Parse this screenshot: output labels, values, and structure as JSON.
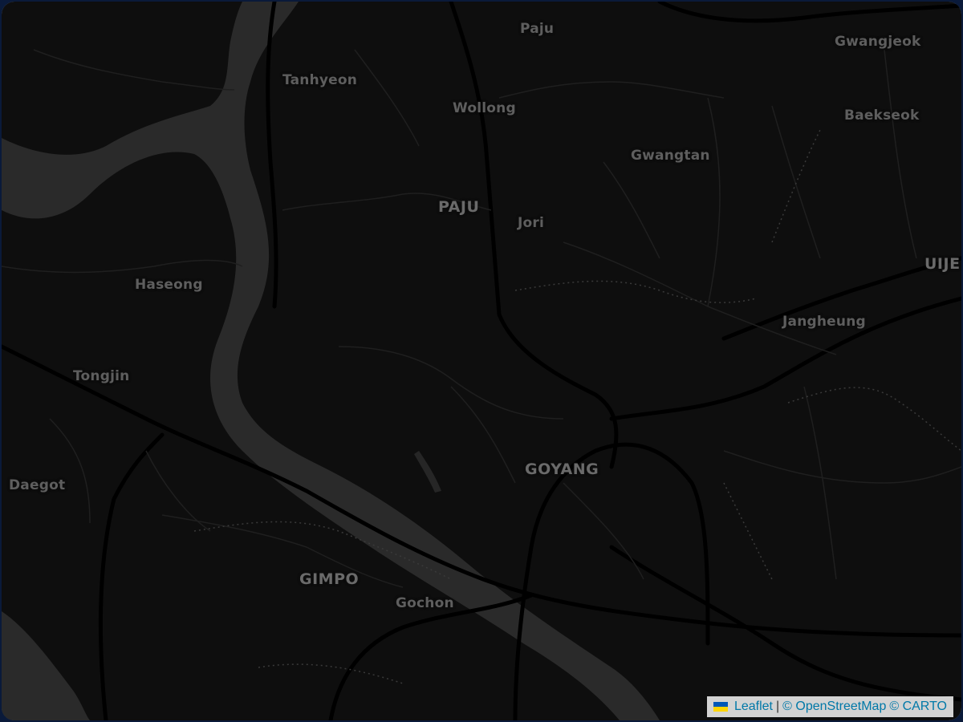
{
  "map": {
    "colors": {
      "land": "#0e0e0e",
      "water": "#2a2a2a",
      "road_major": "#000000",
      "road_minor": "#1e1e1e",
      "label": "#5e5e5e",
      "border": "#8fa6d6"
    },
    "labels": [
      {
        "name": "Paju"
      },
      {
        "name": "Gwangjeok"
      },
      {
        "name": "Tanhyeon"
      },
      {
        "name": "Wollong"
      },
      {
        "name": "Baekseok"
      },
      {
        "name": "Gwangtan"
      },
      {
        "name": "PAJU"
      },
      {
        "name": "Jori"
      },
      {
        "name": "UIJE"
      },
      {
        "name": "Haseong"
      },
      {
        "name": "Jangheung"
      },
      {
        "name": "Tongjin"
      },
      {
        "name": "GOYANG"
      },
      {
        "name": "Daegot"
      },
      {
        "name": "GIMPO"
      },
      {
        "name": "Gochon"
      }
    ]
  },
  "attribution": {
    "flag_icon": "ukraine-flag-icon",
    "leaflet": "Leaflet",
    "separator": "|",
    "osm": "© OpenStreetMap",
    "carto": "© CARTO"
  }
}
